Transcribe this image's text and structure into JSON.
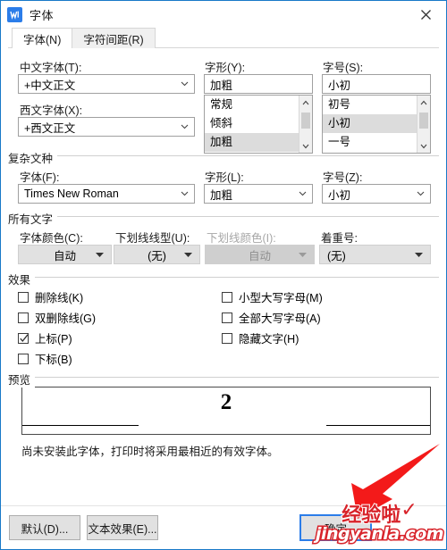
{
  "window": {
    "title": "字体",
    "app_icon": "wps-writer-icon",
    "close_label": "✕",
    "accent_color": "#1879c8"
  },
  "tabs": [
    {
      "label": "字体(N)",
      "active": true
    },
    {
      "label": "字符间距(R)",
      "active": false
    }
  ],
  "latin_section": {
    "chinese_font": {
      "label": "中文字体(T):",
      "value": "+中文正文"
    },
    "western_font": {
      "label": "西文字体(X):",
      "value": "+西文正文"
    },
    "style": {
      "label": "字形(Y):",
      "value": "加粗",
      "options": [
        "常规",
        "倾斜",
        "加粗"
      ],
      "selected": "加粗"
    },
    "size": {
      "label": "字号(S):",
      "value": "小初",
      "options": [
        "初号",
        "小初",
        "一号"
      ],
      "selected": "小初"
    }
  },
  "complex_section": {
    "title": "复杂文种",
    "font": {
      "label": "字体(F):",
      "value": "Times New Roman"
    },
    "style": {
      "label": "字形(L):",
      "value": "加粗"
    },
    "size": {
      "label": "字号(Z):",
      "value": "小初"
    }
  },
  "all_text_section": {
    "title": "所有文字",
    "font_color": {
      "label": "字体颜色(C):",
      "value": "自动",
      "disabled": false
    },
    "underline_style": {
      "label": "下划线线型(U):",
      "value": "(无)",
      "disabled": false
    },
    "underline_color": {
      "label": "下划线颜色(I):",
      "value": "自动",
      "disabled": true
    },
    "emphasis_mark": {
      "label": "着重号:",
      "value": "(无)",
      "disabled": false
    }
  },
  "effects_section": {
    "title": "效果",
    "left": [
      {
        "label": "删除线(K)",
        "checked": false
      },
      {
        "label": "双删除线(G)",
        "checked": false
      },
      {
        "label": "上标(P)",
        "checked": true
      },
      {
        "label": "下标(B)",
        "checked": false
      }
    ],
    "right": [
      {
        "label": "小型大写字母(M)",
        "checked": false
      },
      {
        "label": "全部大写字母(A)",
        "checked": false
      },
      {
        "label": "隐藏文字(H)",
        "checked": false
      }
    ]
  },
  "preview_section": {
    "title": "预览",
    "sample_text": "2",
    "note": "尚未安装此字体，打印时将采用最相近的有效字体。"
  },
  "footer": {
    "default_button": "默认(D)...",
    "text_effects_button": "文本效果(E)...",
    "ok_button": "确定"
  },
  "watermark": {
    "chinese": "经验啦",
    "check": "✓",
    "domain": "jingyanla.com",
    "color": "#d8232a"
  }
}
